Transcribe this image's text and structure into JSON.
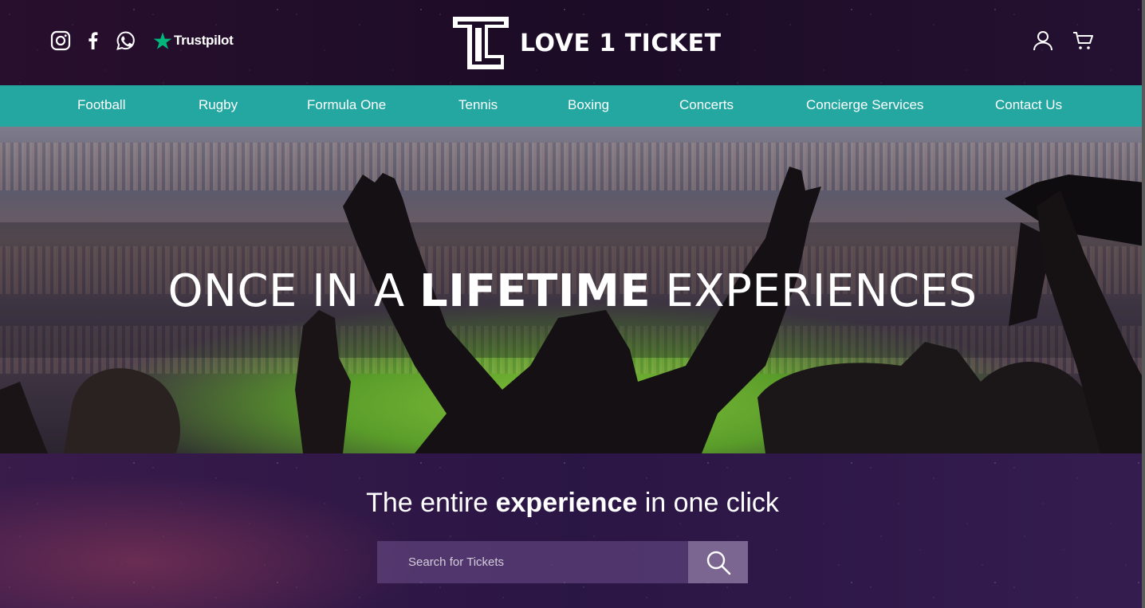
{
  "brand": {
    "name": "LOVE 1 TICKET",
    "accent_color": "#23a7a0"
  },
  "header": {
    "social_icons": [
      "instagram-icon",
      "facebook-icon",
      "whatsapp-icon"
    ],
    "trustpilot_label": "Trustpilot",
    "right_icons": [
      "user-icon",
      "cart-icon"
    ]
  },
  "nav": {
    "items": [
      {
        "label": "Football"
      },
      {
        "label": "Rugby"
      },
      {
        "label": "Formula One"
      },
      {
        "label": "Tennis"
      },
      {
        "label": "Boxing"
      },
      {
        "label": "Concerts"
      },
      {
        "label": "Concierge Services"
      },
      {
        "label": "Contact Us"
      }
    ]
  },
  "hero": {
    "title_prefix": "ONCE IN A ",
    "title_bold": "LIFETIME",
    "title_suffix": " EXPERIENCES"
  },
  "lower": {
    "tagline_prefix": "The entire ",
    "tagline_bold": "experience",
    "tagline_suffix": " in one click",
    "search_placeholder": "Search for Tickets",
    "search_icon": "search-icon"
  }
}
